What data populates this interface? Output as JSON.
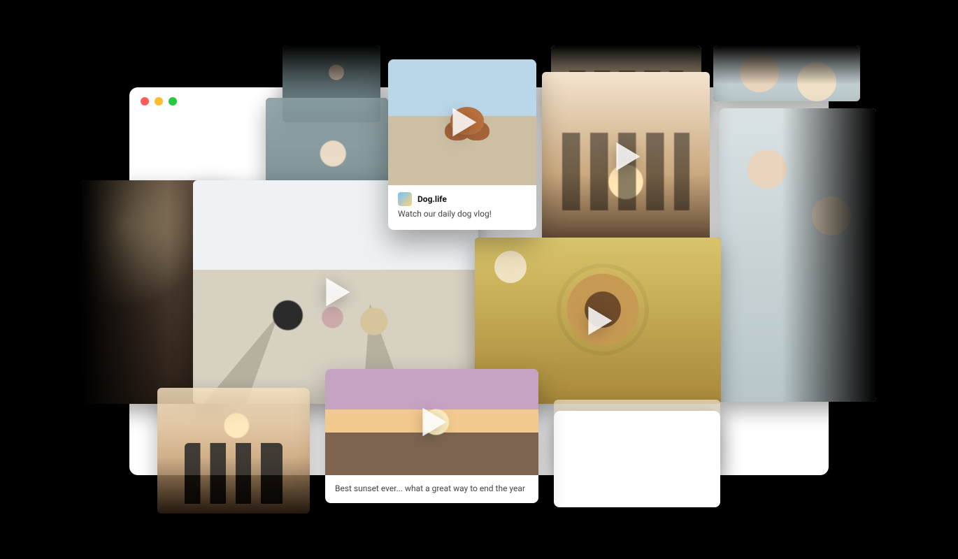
{
  "cards": {
    "dog": {
      "author": "Dog.life",
      "caption": "Watch our daily dog vlog!"
    },
    "sunset": {
      "caption": "Best sunset ever... what a great way to end the year"
    }
  }
}
